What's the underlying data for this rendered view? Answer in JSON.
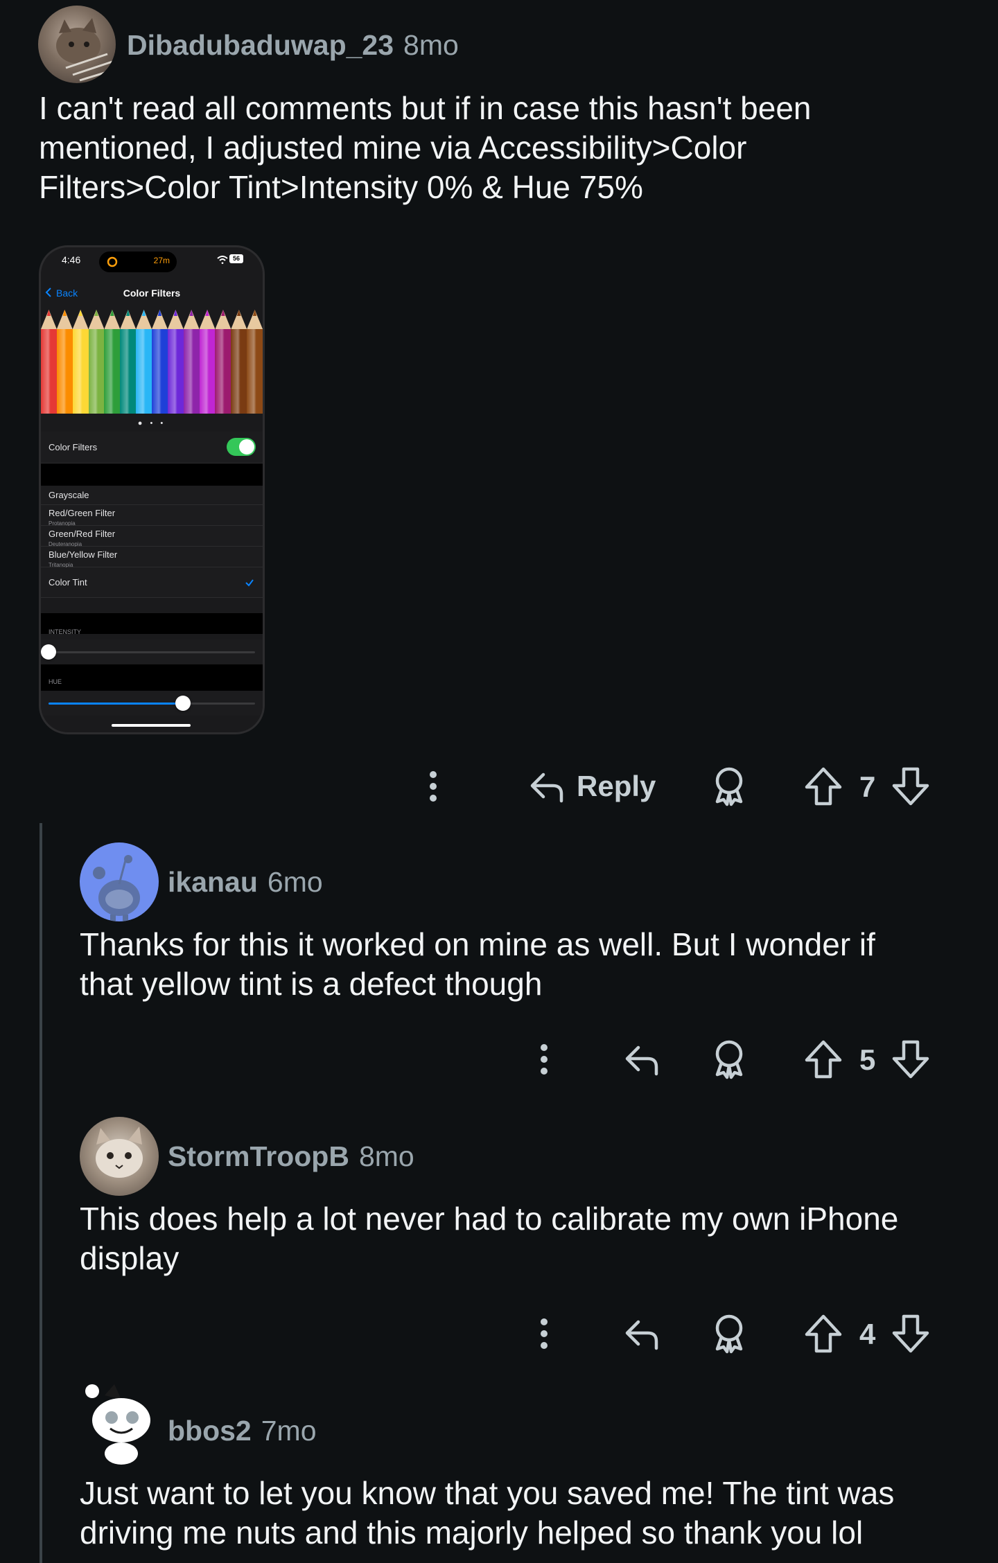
{
  "comments": [
    {
      "username": "Dibadubaduwap_23",
      "age": "8mo",
      "body_lines": [
        "I can't read all comments but if in case this hasn't been",
        "mentioned, I adjusted mine via Accessibility>Color",
        "Filters>Color Tint>Intensity 0% & Hue 75%"
      ],
      "reply_label": "Reply",
      "votes": "7"
    },
    {
      "username": "ikanau",
      "age": "6mo",
      "body_lines": [
        "Thanks for this it worked on mine as well. But I wonder if",
        "that yellow tint is a defect though"
      ],
      "votes": "5"
    },
    {
      "username": "StormTroopB",
      "age": "8mo",
      "body_lines": [
        "This does help a lot never had to calibrate my own iPhone",
        "display"
      ],
      "votes": "4"
    },
    {
      "username": "bbos2",
      "age": "7mo",
      "body_lines": [
        "Just want to let you know that you saved me! The tint was",
        "driving me nuts and this majorly helped so thank you lol"
      ]
    }
  ],
  "attachment": {
    "status_time": "4:46",
    "status_timer": "27m",
    "battery": "56",
    "nav_back": "Back",
    "nav_title": "Color Filters",
    "toggle_label": "Color Filters",
    "toggle_on": true,
    "filters": [
      {
        "label": "Grayscale",
        "sub": ""
      },
      {
        "label": "Red/Green Filter",
        "sub": "Protanopia"
      },
      {
        "label": "Green/Red Filter",
        "sub": "Deuteranopia"
      },
      {
        "label": "Blue/Yellow Filter",
        "sub": "Tritanopia"
      },
      {
        "label": "Color Tint",
        "sub": ""
      }
    ],
    "selected_filter": "Color Tint",
    "intensity_label": "INTENSITY",
    "intensity_value": 0,
    "hue_label": "HUE",
    "hue_value": 0.65,
    "pencil_colors": [
      "#e53935",
      "#fb8c00",
      "#fdd835",
      "#7cb342",
      "#2e9e3a",
      "#00897b",
      "#29b6f6",
      "#1e40d8",
      "#6d28d9",
      "#8e24aa",
      "#c026d3",
      "#9c1a6e",
      "#7a3b12",
      "#8d4a16"
    ]
  },
  "colors": {
    "background": "#0e1113",
    "text": "#f2f4f5",
    "meta": "#9aa6ad",
    "icon": "#c7d0d5"
  },
  "icons": [
    "more-vertical-icon",
    "reply-icon",
    "award-icon",
    "upvote-icon",
    "downvote-icon"
  ]
}
